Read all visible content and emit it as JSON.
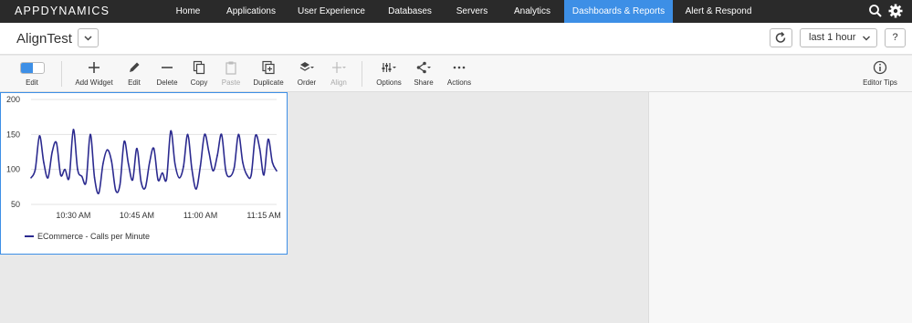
{
  "brand": "APPDYNAMICS",
  "nav": [
    {
      "label": "Home",
      "active": false
    },
    {
      "label": "Applications",
      "active": false
    },
    {
      "label": "User Experience",
      "active": false
    },
    {
      "label": "Databases",
      "active": false
    },
    {
      "label": "Servers",
      "active": false
    },
    {
      "label": "Analytics",
      "active": false
    },
    {
      "label": "Dashboards & Reports",
      "active": true
    },
    {
      "label": "Alert & Respond",
      "active": false
    }
  ],
  "top_icons": [
    "search-icon",
    "gear-icon"
  ],
  "dashboard": {
    "title": "AlignTest",
    "time_range": "last 1 hour",
    "help_label": "?"
  },
  "toolbar": {
    "edit_label": "Edit",
    "tools": [
      {
        "label": "Add Widget",
        "icon": "plus-icon",
        "disabled": false
      },
      {
        "label": "Edit",
        "icon": "pencil-icon",
        "disabled": false
      },
      {
        "label": "Delete",
        "icon": "minus-icon",
        "disabled": false
      },
      {
        "label": "Copy",
        "icon": "copy-icon",
        "disabled": false
      },
      {
        "label": "Paste",
        "icon": "clipboard-icon",
        "disabled": true
      },
      {
        "label": "Duplicate",
        "icon": "duplicate-icon",
        "disabled": false
      },
      {
        "label": "Order",
        "icon": "layers-icon",
        "disabled": false
      },
      {
        "label": "Align",
        "icon": "align-icon",
        "disabled": true
      },
      {
        "label": "Options",
        "icon": "sliders-icon",
        "disabled": false
      },
      {
        "label": "Share",
        "icon": "share-icon",
        "disabled": false
      },
      {
        "label": "Actions",
        "icon": "ellipsis-icon",
        "disabled": false
      }
    ],
    "editor_tips_label": "Editor Tips"
  },
  "colors": {
    "accent": "#3d8fe6",
    "series": "#2b2a8f",
    "topbar": "#2a2a2a"
  },
  "chart_data": {
    "type": "line",
    "ylim": [
      50,
      200
    ],
    "yticks": [
      50,
      100,
      150,
      200
    ],
    "x_range": [
      0,
      58
    ],
    "xticks": [
      {
        "x": 10,
        "label": "10:30 AM"
      },
      {
        "x": 25,
        "label": "10:45 AM"
      },
      {
        "x": 40,
        "label": "11:00 AM"
      },
      {
        "x": 55,
        "label": "11:15 AM"
      }
    ],
    "grid": true,
    "legend_position": "bottom-left",
    "series": [
      {
        "name": "ECommerce - Calls per Minute",
        "x": [
          0,
          1,
          2,
          3,
          4,
          5,
          6,
          7,
          8,
          9,
          10,
          11,
          12,
          13,
          14,
          15,
          16,
          17,
          18,
          19,
          20,
          21,
          22,
          23,
          24,
          25,
          26,
          27,
          28,
          29,
          30,
          31,
          32,
          33,
          34,
          35,
          36,
          37,
          38,
          39,
          40,
          41,
          42,
          43,
          44,
          45,
          46,
          47,
          48,
          49,
          50,
          51,
          52,
          53,
          54,
          55,
          56,
          57,
          58
        ],
        "values": [
          88,
          100,
          148,
          110,
          88,
          125,
          138,
          92,
          100,
          88,
          157,
          100,
          90,
          82,
          150,
          88,
          66,
          108,
          128,
          112,
          70,
          78,
          140,
          108,
          85,
          130,
          82,
          74,
          110,
          130,
          85,
          95,
          86,
          155,
          108,
          88,
          104,
          150,
          100,
          72,
          105,
          150,
          125,
          98,
          120,
          150,
          98,
          90,
          103,
          150,
          110,
          92,
          92,
          148,
          130,
          92,
          143,
          110,
          98
        ]
      }
    ]
  }
}
